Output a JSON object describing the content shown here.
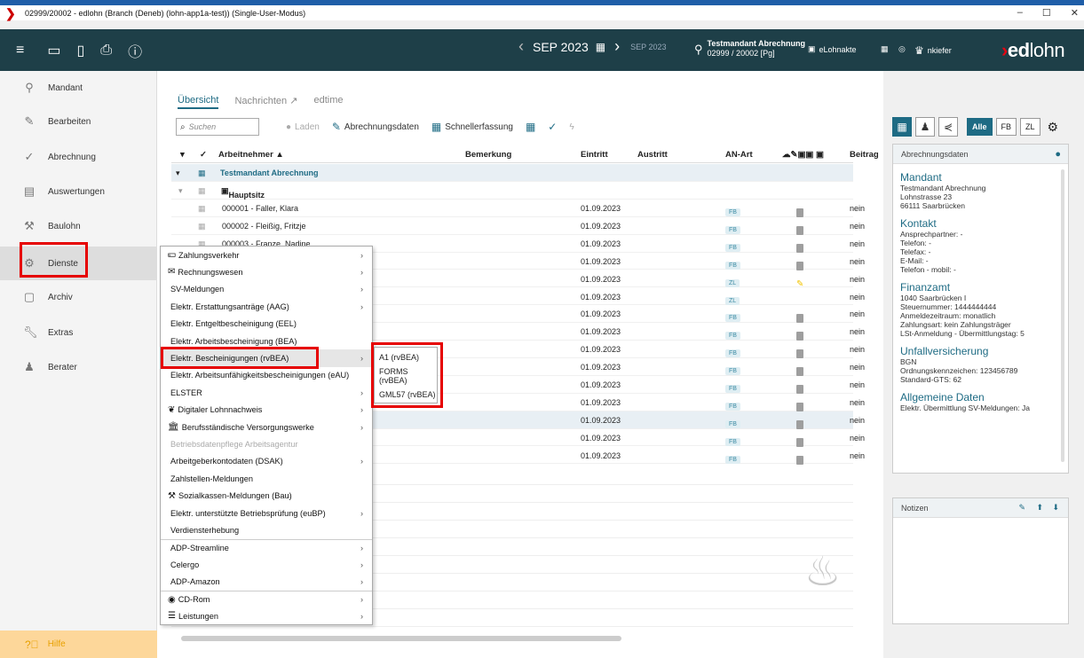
{
  "window": {
    "title": "02999/20002 - edlohn (Branch (Deneb) (lohn-app1a-test)) (Single-User-Modus)",
    "min": "–",
    "max": "☐",
    "close": "✕"
  },
  "topbar": {
    "period": "SEP 2023",
    "period_small": "SEP 2023",
    "mandant_name": "Testmandant Abrechnung",
    "mandant_id": "02999 / 20002 [Pg]",
    "elohnakte": "eLohnakte",
    "user": "nkiefer",
    "logo_ed": "ed",
    "logo_lohn": "lohn"
  },
  "sidebar": {
    "items": [
      {
        "label": "Mandant",
        "icon": "location-pin-icon"
      },
      {
        "label": "Bearbeiten",
        "icon": "pencil-icon"
      },
      {
        "label": "Abrechnung",
        "icon": "check-icon"
      },
      {
        "label": "Auswertungen",
        "icon": "document-icon"
      },
      {
        "label": "Baulohn",
        "icon": "worker-icon"
      },
      {
        "label": "Dienste",
        "icon": "gears-icon"
      },
      {
        "label": "Archiv",
        "icon": "archive-icon"
      },
      {
        "label": "Extras",
        "icon": "wrench-icon"
      },
      {
        "label": "Berater",
        "icon": "advisor-icon"
      }
    ],
    "help": "Hilfe"
  },
  "tabs": [
    "Übersicht",
    "Nachrichten",
    "edtime"
  ],
  "toolbar": {
    "search_placeholder": "Suchen",
    "laden": "Laden",
    "abrechnungsdaten": "Abrechnungsdaten",
    "schnellerfassung": "Schnellerfassung"
  },
  "grid": {
    "headers": {
      "check": "✓",
      "arbeitnehmer": "Arbeitnehmer ▲",
      "bemerkung": "Bemerkung",
      "eintritt": "Eintritt",
      "austritt": "Austritt",
      "anart": "AN-Art",
      "beitrag": "Beitrag"
    },
    "group1": "Testmandant Abrechnung",
    "group2": "Hauptsitz",
    "rows": [
      {
        "name": "000001 - Faller, Klara",
        "eintritt": "01.09.2023",
        "anart": "FB",
        "pen": "",
        "beitrag": "nein"
      },
      {
        "name": "000002 - Fleißig, Fritzje",
        "eintritt": "01.09.2023",
        "anart": "FB",
        "pen": "",
        "beitrag": "nein"
      },
      {
        "name": "000003 - Franze, Nadine",
        "eintritt": "01.09.2023",
        "anart": "FB",
        "pen": "✎",
        "beitrag": "nein"
      },
      {
        "name": "",
        "eintritt": "01.09.2023",
        "anart": "FB",
        "pen": "✎",
        "beitrag": "nein"
      },
      {
        "name": "",
        "eintritt": "01.09.2023",
        "anart": "ZL",
        "pen": "✎",
        "beitrag": "nein"
      },
      {
        "name": "",
        "eintritt": "01.09.2023",
        "anart": "ZL",
        "pen": "",
        "beitrag": "nein"
      },
      {
        "name": "",
        "eintritt": "01.09.2023",
        "anart": "FB",
        "pen": "",
        "beitrag": "nein"
      },
      {
        "name": "",
        "eintritt": "01.09.2023",
        "anart": "FB",
        "pen": "✎",
        "beitrag": "nein"
      },
      {
        "name": "",
        "eintritt": "01.09.2023",
        "anart": "FB",
        "pen": "✎",
        "beitrag": "nein"
      },
      {
        "name": "",
        "eintritt": "01.09.2023",
        "anart": "FB",
        "pen": "",
        "beitrag": "nein"
      },
      {
        "name": "",
        "eintritt": "01.09.2023",
        "anart": "FB",
        "pen": "✎",
        "beitrag": "nein"
      },
      {
        "name": "",
        "eintritt": "01.09.2023",
        "anart": "FB",
        "pen": "",
        "beitrag": "nein"
      },
      {
        "name": "",
        "eintritt": "01.09.2023",
        "anart": "FB",
        "pen": "",
        "beitrag": "nein"
      },
      {
        "name": "",
        "eintritt": "01.09.2023",
        "anart": "FB",
        "pen": "",
        "beitrag": "nein"
      },
      {
        "name": "",
        "eintritt": "01.09.2023",
        "anart": "FB",
        "pen": "",
        "beitrag": "nein"
      }
    ]
  },
  "context_menu": [
    {
      "label": "Zahlungsverkehr",
      "sub": true,
      "icon": "money-icon"
    },
    {
      "label": "Rechnungswesen",
      "sub": true,
      "icon": "ledger-icon"
    },
    {
      "label": "SV-Meldungen",
      "sub": true
    },
    {
      "label": "Elektr. Erstattungsanträge (AAG)",
      "sub": true
    },
    {
      "label": "Elektr. Entgeltbescheinigung (EEL)",
      "sub": false
    },
    {
      "label": "Elektr. Arbeitsbescheinigung (BEA)",
      "sub": false
    },
    {
      "label": "Elektr. Bescheinigungen (rvBEA)",
      "sub": true,
      "selected": true
    },
    {
      "label": "Elektr. Arbeitsunfähigkeitsbescheinigungen (eAU)",
      "sub": false
    },
    {
      "label": "ELSTER",
      "sub": true
    },
    {
      "label": "Digitaler Lohnnachweis",
      "sub": true,
      "icon": "dln-icon"
    },
    {
      "label": "Berufsständische Versorgungswerke",
      "sub": true,
      "icon": "building-icon"
    },
    {
      "label": "Betriebsdatenpflege Arbeitsagentur",
      "sub": false,
      "disabled": true
    },
    {
      "label": "Arbeitgeberkontodaten (DSAK)",
      "sub": true
    },
    {
      "label": "Zahlstellen-Meldungen",
      "sub": false
    },
    {
      "label": "Sozialkassen-Meldungen (Bau)",
      "sub": false,
      "icon": "worker-icon"
    },
    {
      "label": "Elektr. unterstützte Betriebsprüfung (euBP)",
      "sub": true
    },
    {
      "label": "Verdiensterhebung",
      "sub": false
    },
    {
      "label": "ADP-Streamline",
      "sub": true
    },
    {
      "label": "Celergo",
      "sub": true
    },
    {
      "label": "ADP-Amazon",
      "sub": true
    },
    {
      "label": "CD-Rom",
      "sub": true,
      "icon": "cd-icon"
    },
    {
      "label": "Leistungen",
      "sub": true,
      "icon": "list-icon"
    }
  ],
  "submenu": [
    "A1 (rvBEA)",
    "FORMS (rvBEA)",
    "GML57 (rvBEA)"
  ],
  "rpanel": {
    "filter_all": "Alle",
    "filter_fb": "FB",
    "filter_zl": "ZL",
    "card_title": "Abrechnungsdaten",
    "sections": [
      {
        "h": "Mandant",
        "lines": [
          "Testmandant Abrechnung",
          "Lohnstrasse 23",
          "66111 Saarbrücken"
        ]
      },
      {
        "h": "Kontakt",
        "lines": [
          "Ansprechpartner: -",
          "Telefon: -",
          "Telefax: -",
          "E-Mail: -",
          "Telefon - mobil: -"
        ]
      },
      {
        "h": "Finanzamt",
        "lines": [
          "1040 Saarbrücken I",
          "Steuernummer: 1444444444",
          "Anmeldezeitraum: monatlich",
          "Zahlungsart: kein Zahlungsträger",
          "LSt-Anmeldung - Übermittlungstag: 5"
        ]
      },
      {
        "h": "Unfallversicherung",
        "lines": [
          "BGN",
          "Ordnungskennzeichen: 123456789",
          "Standard-GTS: 62"
        ]
      },
      {
        "h": "Allgemeine Daten",
        "lines": [
          "Elektr. Übermittlung SV-Meldungen: Ja"
        ]
      }
    ],
    "notes_title": "Notizen"
  }
}
